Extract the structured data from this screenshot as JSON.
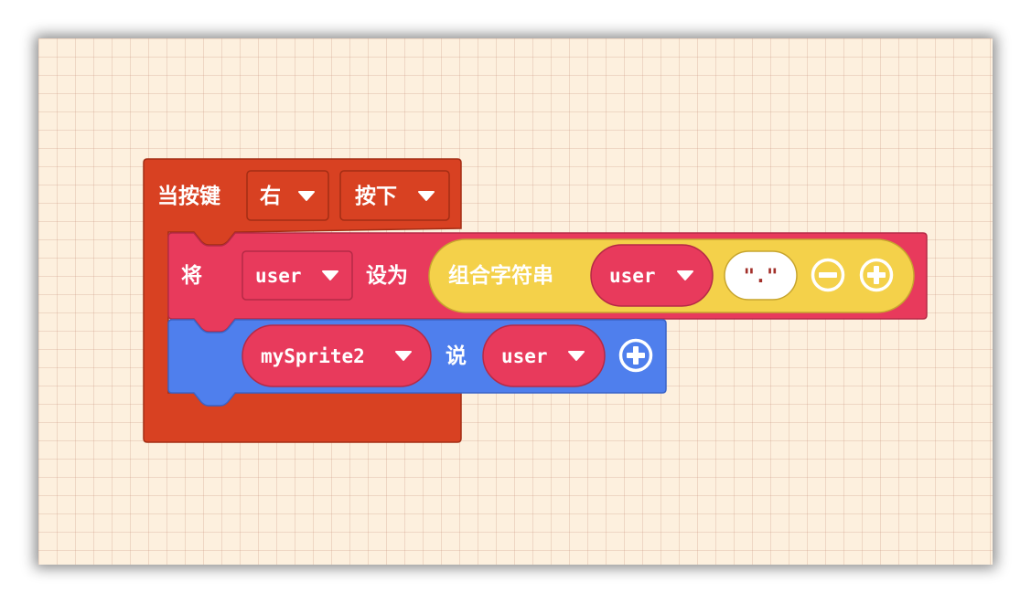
{
  "event_block": {
    "label": "当按键",
    "key_dropdown": "右",
    "action_dropdown": "按下",
    "color": "#d84122"
  },
  "set_block": {
    "label": "将",
    "variable_dropdown": "user",
    "assign_label": "设为",
    "color": "#e83a5c",
    "join_block": {
      "label": "组合字符串",
      "item_dropdown": "user",
      "text_value": "\".\"",
      "color": "#f4d14a"
    }
  },
  "say_block": {
    "sprite_dropdown": "mySprite2",
    "say_label": "说",
    "value_dropdown": "user",
    "color": "#4f7fed"
  }
}
